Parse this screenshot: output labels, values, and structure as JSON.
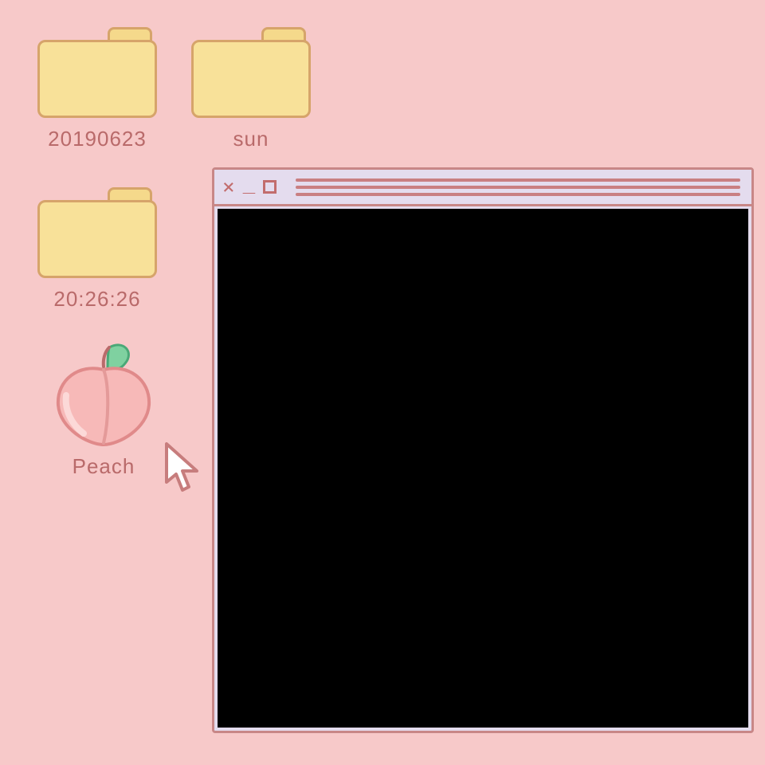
{
  "desktop": {
    "background_color": "#f7c9c9",
    "label_color": "#b96a6a",
    "icons": [
      {
        "kind": "folder",
        "label": "20190623",
        "icon_name": "folder-icon"
      },
      {
        "kind": "folder",
        "label": "sun",
        "icon_name": "folder-icon"
      },
      {
        "kind": "folder",
        "label": "20:26:26",
        "icon_name": "folder-icon"
      },
      {
        "kind": "peach",
        "label": "Peach",
        "icon_name": "peach-icon"
      }
    ]
  },
  "cursor": {
    "icon_name": "arrow-cursor-icon"
  },
  "window": {
    "titlebar": {
      "close_symbol": "×",
      "minimize_symbol": "_",
      "maximize_symbol": "□",
      "background_color": "#e4dcee",
      "border_color": "#c88787"
    },
    "content_color": "#000000"
  }
}
